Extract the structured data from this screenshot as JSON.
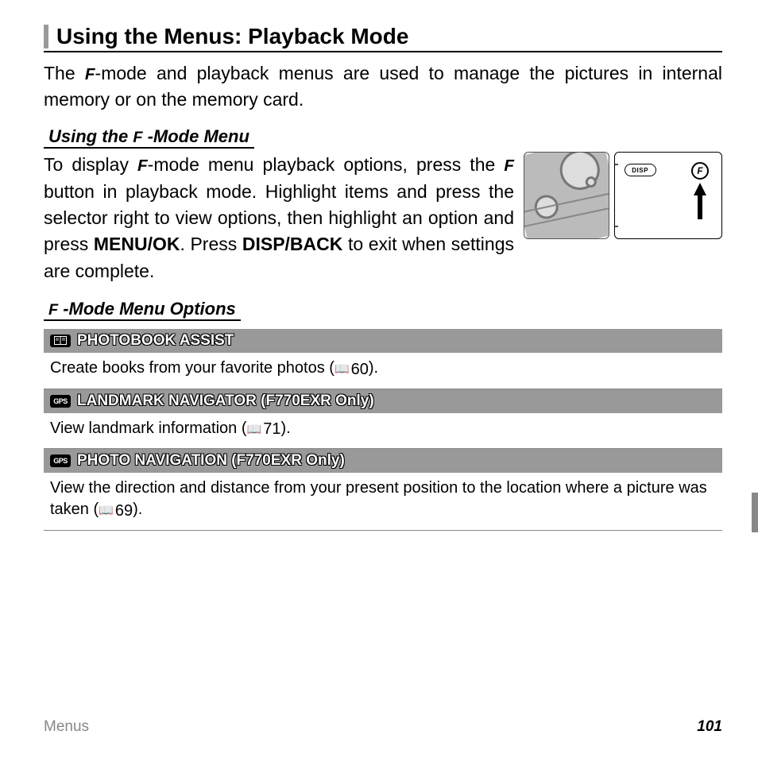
{
  "title": "Using the Menus: Playback Mode",
  "intro_pre": "The ",
  "intro_post": "-mode and playback menus are used to manage the pictures in internal memory or on the memory card.",
  "sub1_pre": "Using the ",
  "sub1_post": "-Mode Menu",
  "body1_a": "To display ",
  "body1_b": "-mode menu playback options, press the ",
  "body1_c": " button in playback mode.  Highlight items and press the selector right to view options, then highlight an option and press ",
  "body1_d": ".  Press ",
  "body1_e": " to exit when settings are complete.",
  "menu_ok": "MENU/OK",
  "disp_back": "DISP/BACK",
  "disp_label": "DISP",
  "f_label": "F",
  "sub2_post": "-Mode Menu Options",
  "options": [
    {
      "icon": "⬛",
      "icon_class": "photobook",
      "title": "PHOTOBOOK ASSIST",
      "desc_pre": "Create books from your favorite photos (",
      "page": " 60",
      "desc_post": ")."
    },
    {
      "icon": "GPS",
      "icon_class": "gps",
      "title": "LANDMARK NAVIGATOR (F770EXR Only)",
      "desc_pre": "View landmark information (",
      "page": " 71",
      "desc_post": ")."
    },
    {
      "icon": "GPS",
      "icon_class": "gps",
      "title": "PHOTO NAVIGATION (F770EXR Only)",
      "desc_pre": "View the direction and distance from your present position to the location where a picture was taken (",
      "page": " 69",
      "desc_post": ")."
    }
  ],
  "footer_left": "Menus",
  "footer_right": "101"
}
